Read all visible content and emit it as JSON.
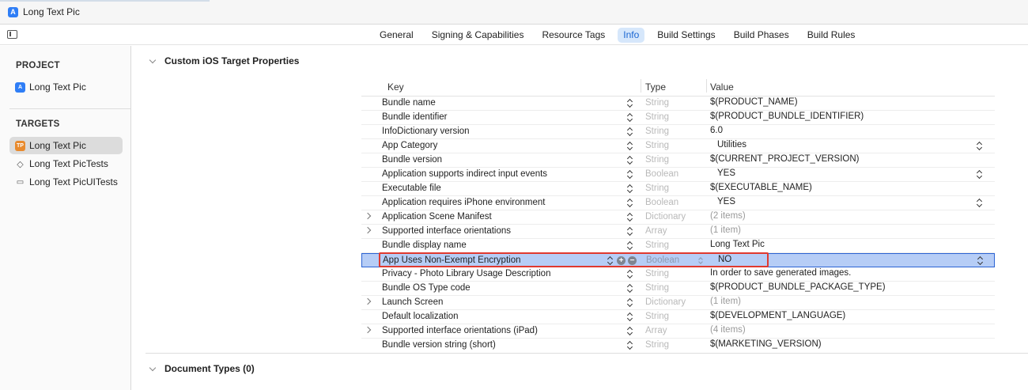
{
  "window": {
    "title": "Long Text Pic",
    "app_icon": "xcode-app-icon"
  },
  "toolbar": {
    "tabs": [
      {
        "label": "General",
        "active": false
      },
      {
        "label": "Signing & Capabilities",
        "active": false
      },
      {
        "label": "Resource Tags",
        "active": false
      },
      {
        "label": "Info",
        "active": true
      },
      {
        "label": "Build Settings",
        "active": false
      },
      {
        "label": "Build Phases",
        "active": false
      },
      {
        "label": "Build Rules",
        "active": false
      }
    ]
  },
  "sidebar": {
    "project_header": "PROJECT",
    "project_item": "Long Text Pic",
    "targets_header": "TARGETS",
    "targets": [
      {
        "label": "Long Text Pic",
        "icon": "app-target-icon",
        "selected": true
      },
      {
        "label": "Long Text PicTests",
        "icon": "unit-test-icon",
        "selected": false
      },
      {
        "label": "Long Text PicUITests",
        "icon": "ui-test-icon",
        "selected": false
      }
    ]
  },
  "main": {
    "custom_props_title": "Custom iOS Target Properties",
    "document_types_title": "Document Types (0)",
    "table": {
      "headers": {
        "key": "Key",
        "type": "Type",
        "value": "Value"
      },
      "rows": [
        {
          "key": "Bundle name",
          "type": "String",
          "value": "$(PRODUCT_NAME)"
        },
        {
          "key": "Bundle identifier",
          "type": "String",
          "value": "$(PRODUCT_BUNDLE_IDENTIFIER)"
        },
        {
          "key": "InfoDictionary version",
          "type": "String",
          "value": "6.0"
        },
        {
          "key": "App Category",
          "type": "String",
          "value": "Utilities"
        },
        {
          "key": "Bundle version",
          "type": "String",
          "value": "$(CURRENT_PROJECT_VERSION)"
        },
        {
          "key": "Application supports indirect input events",
          "type": "Boolean",
          "value": "YES"
        },
        {
          "key": "Executable file",
          "type": "String",
          "value": "$(EXECUTABLE_NAME)"
        },
        {
          "key": "Application requires iPhone environment",
          "type": "Boolean",
          "value": "YES"
        },
        {
          "key": "Application Scene Manifest",
          "type": "Dictionary",
          "value": "(2 items)"
        },
        {
          "key": "Supported interface orientations",
          "type": "Array",
          "value": "(1 item)"
        },
        {
          "key": "Bundle display name",
          "type": "String",
          "value": "Long Text Pic"
        },
        {
          "key": "App Uses Non-Exempt Encryption",
          "type": "Boolean",
          "value": "NO"
        },
        {
          "key": "Privacy - Photo Library Usage Description",
          "type": "String",
          "value": "In order to save generated images."
        },
        {
          "key": "Bundle OS Type code",
          "type": "String",
          "value": "$(PRODUCT_BUNDLE_PACKAGE_TYPE)"
        },
        {
          "key": "Launch Screen",
          "type": "Dictionary",
          "value": "(1 item)"
        },
        {
          "key": "Default localization",
          "type": "String",
          "value": "$(DEVELOPMENT_LANGUAGE)"
        },
        {
          "key": "Supported interface orientations (iPad)",
          "type": "Array",
          "value": "(4 items)"
        },
        {
          "key": "Bundle version string (short)",
          "type": "String",
          "value": "$(MARKETING_VERSION)"
        }
      ]
    }
  },
  "colors": {
    "accent": "#2b63d3",
    "selection": "#b6cdf6",
    "highlight_box": "#e0392f",
    "active_tab_bg": "#d6e7fb"
  }
}
